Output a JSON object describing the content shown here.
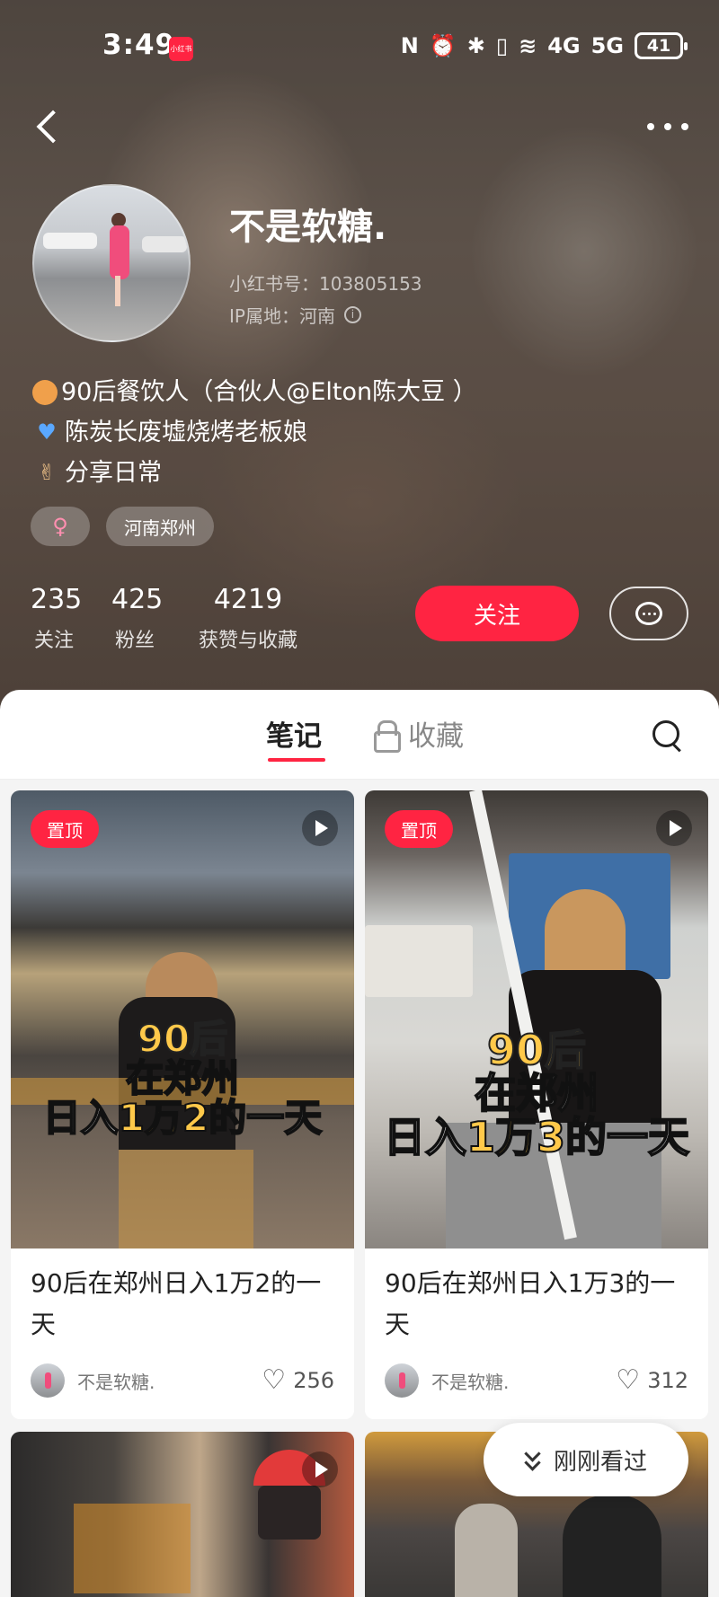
{
  "status_bar": {
    "time": "3:49",
    "app_badge": "小红书",
    "signal_4g": "4G",
    "signal_5g": "5G",
    "battery": "41"
  },
  "profile": {
    "name": "不是软糖.",
    "red_id": "小红书号：103805153",
    "ip_location": "IP属地：河南",
    "bio": [
      "90后餐饮人（合伙人@Elton陈大豆 ）",
      "陈炭长废墟烧烤老板娘",
      "分享日常"
    ],
    "tags": {
      "gender_symbol": "♀",
      "location": "河南郑州"
    },
    "stats": [
      {
        "value": "235",
        "label": "关注"
      },
      {
        "value": "425",
        "label": "粉丝"
      },
      {
        "value": "4219",
        "label": "获赞与收藏"
      }
    ],
    "follow_label": "关注"
  },
  "tabs": {
    "notes": "笔记",
    "favorites": "收藏"
  },
  "feed": [
    {
      "pin_label": "置顶",
      "overlay": {
        "line1": "90后",
        "line2": "在郑州",
        "line3_pre": "日入",
        "line3_hl": "1万2",
        "line3_post": "的一天"
      },
      "title": "90后在郑州日入1万2的一天",
      "author": "不是软糖.",
      "likes": "256"
    },
    {
      "pin_label": "置顶",
      "overlay": {
        "line1": "90后",
        "line2": "在郑州",
        "line3_pre": "日入",
        "line3_hl": "1万3",
        "line3_post": "的一天"
      },
      "title": "90后在郑州日入1万3的一天",
      "author": "不是软糖.",
      "likes": "312"
    }
  ],
  "recent_button": "刚刚看过",
  "icons": {
    "back": "back-arrow-icon",
    "more": "more-dots-icon",
    "info": "info-icon",
    "chat": "chat-bubble-icon",
    "lock": "lock-icon",
    "search": "search-icon",
    "play": "play-icon",
    "heart": "heart-icon"
  },
  "colors": {
    "accent": "#ff2442",
    "highlight": "#ffc94a"
  }
}
